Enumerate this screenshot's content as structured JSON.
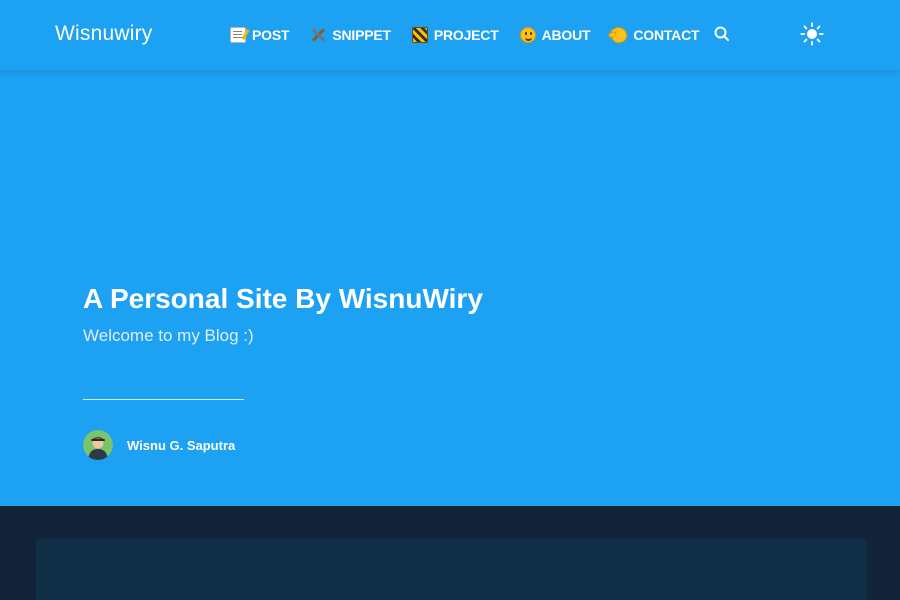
{
  "navbar": {
    "brand": "Wisnuwiry",
    "items": [
      {
        "icon": "memo-icon",
        "label": "POST"
      },
      {
        "icon": "hammer-wrench-icon",
        "label": "SNIPPET"
      },
      {
        "icon": "construction-icon",
        "label": "PROJECT"
      },
      {
        "icon": "smile-icon",
        "label": "ABOUT"
      },
      {
        "icon": "call-me-hand-icon",
        "label": "CONTACT"
      }
    ],
    "search_icon": "search-icon",
    "theme_icon": "sun-icon"
  },
  "hero": {
    "title": "A Personal Site By WisnuWiry",
    "subtitle": "Welcome to my Blog :)",
    "author_name": "Wisnu G. Saputra"
  },
  "colors": {
    "primary": "#1da1f2",
    "page_background": "#13243a",
    "card_background": "#112e47",
    "text": "#ffffff"
  }
}
